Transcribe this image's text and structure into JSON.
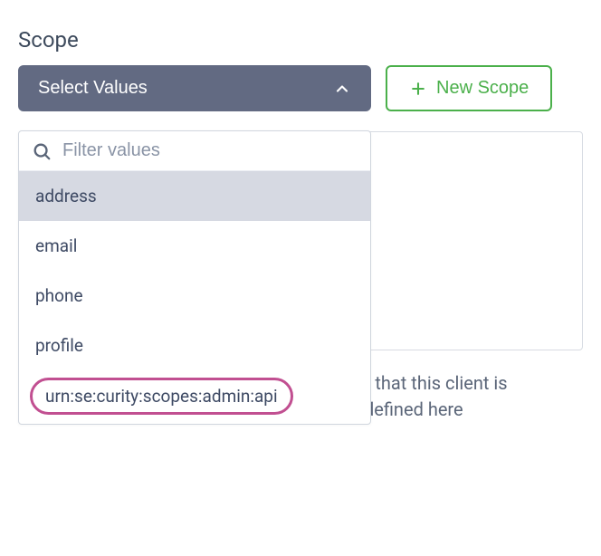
{
  "label": "Scope",
  "select": {
    "placeholder_label": "Select Values"
  },
  "new_scope_button": {
    "label": "New Scope"
  },
  "filter": {
    "placeholder": "Filter values"
  },
  "options": {
    "0": "address",
    "1": "email",
    "2": "phone",
    "3": "profile",
    "4": "urn:se:curity:scopes:admin:api"
  },
  "help_text": "A subset of the scopes defined in the profile that this client is allowed to request or all if a subset are not defined here"
}
